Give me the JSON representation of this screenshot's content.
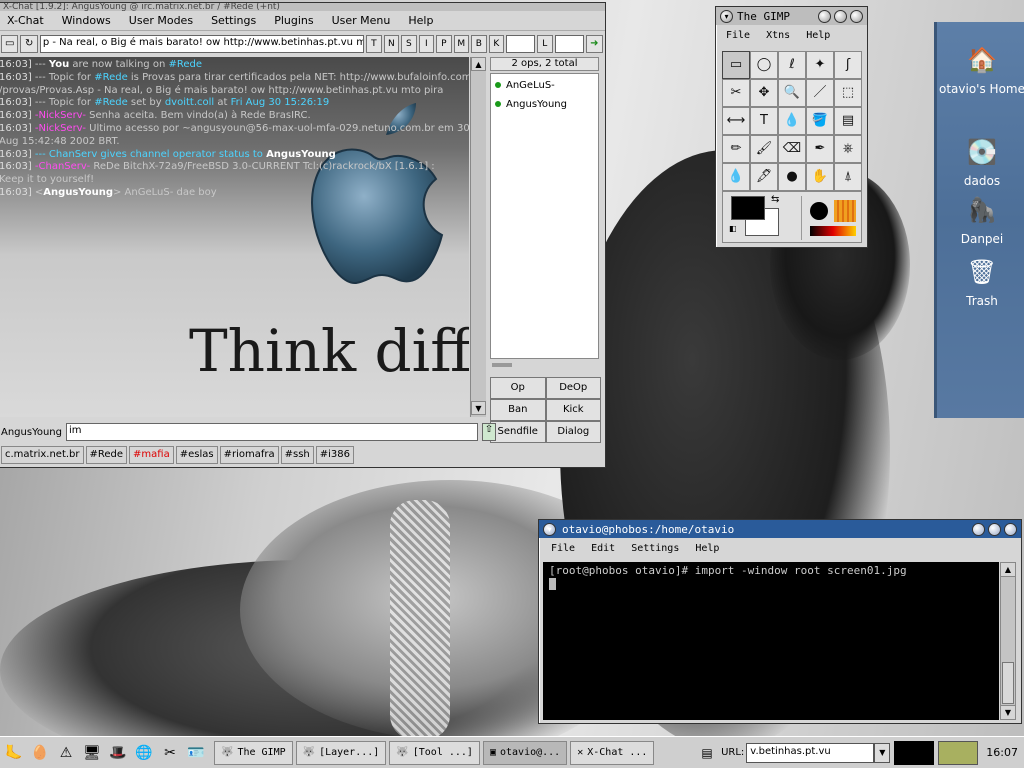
{
  "xchat": {
    "title": "X-Chat [1.9.2]: AngusYoung @ irc.matrix.net.br / #Rede (+nt)",
    "menu": [
      "X-Chat",
      "Windows",
      "User Modes",
      "Settings",
      "Plugins",
      "User Menu",
      "Help"
    ],
    "topic": "p - Na real, o Big é mais barato!  ow http://www.betinhas.pt.vu mto pira",
    "mode_buttons": [
      "T",
      "N",
      "S",
      "I",
      "P",
      "M",
      "B",
      "K"
    ],
    "limit_label": "L",
    "chat_lines": [
      {
        "ts": "16:03]",
        "parts": [
          {
            "t": " --- ",
            "c": "c-gray"
          },
          {
            "t": "You",
            "c": "c-bold"
          },
          {
            "t": " are now talking on ",
            "c": "c-gray"
          },
          {
            "t": "#Rede",
            "c": "c-cyan"
          }
        ]
      },
      {
        "ts": "16:03]",
        "parts": [
          {
            "t": " --- Topic for ",
            "c": "c-gray"
          },
          {
            "t": "#Rede",
            "c": "c-cyan"
          },
          {
            "t": " is Provas para tirar certificados pela NET: http://www.bufaloinfo.com.br",
            "c": "c-gray"
          }
        ]
      },
      {
        "ts": "",
        "parts": [
          {
            "t": "/provas/Provas.Asp - Na real, o Big é mais barato!  ow http://www.betinhas.pt.vu mto pira",
            "c": "c-gray"
          }
        ]
      },
      {
        "ts": "16:03]",
        "parts": [
          {
            "t": " --- Topic for ",
            "c": "c-gray"
          },
          {
            "t": "#Rede",
            "c": "c-cyan"
          },
          {
            "t": " set by ",
            "c": "c-gray"
          },
          {
            "t": "dvoitt.coll",
            "c": "c-cyan"
          },
          {
            "t": " at ",
            "c": "c-gray"
          },
          {
            "t": "Fri Aug 30 15:26:19",
            "c": "c-cyan"
          }
        ]
      },
      {
        "ts": "16:03]",
        "parts": [
          {
            "t": " -NickServ-",
            "c": "c-nick"
          },
          {
            "t": " Senha aceita. Bem vindo(a) à Rede BrasIRC.",
            "c": "c-gray"
          }
        ]
      },
      {
        "ts": "16:03]",
        "parts": [
          {
            "t": " -NickServ-",
            "c": "c-nick"
          },
          {
            "t": " Último acesso por ~angusyoun@56-max-uol-mfa-029.netuno.com.br em 30",
            "c": "c-gray"
          }
        ]
      },
      {
        "ts": "",
        "parts": [
          {
            "t": "Aug 15:42:48 2002 BRT.",
            "c": "c-gray"
          }
        ]
      },
      {
        "ts": "16:03]",
        "parts": [
          {
            "t": " --- ChanServ gives channel operator status to ",
            "c": "c-cyan"
          },
          {
            "t": "AngusYoung",
            "c": "c-bold"
          }
        ]
      },
      {
        "ts": "16:03]",
        "parts": [
          {
            "t": " -ChanServ-",
            "c": "c-nick"
          },
          {
            "t": " ReDe BitchX-72a9/FreeBSD 3.0-CURRENT Tcl:(c)rackrock/bX [1.6.1] :",
            "c": "c-gray"
          }
        ]
      },
      {
        "ts": "",
        "parts": [
          {
            "t": "Keep it to yourself!",
            "c": "c-gray"
          }
        ]
      },
      {
        "ts": "16:03]",
        "parts": [
          {
            "t": " <",
            "c": "c-gray"
          },
          {
            "t": "AngusYoung",
            "c": "c-bold"
          },
          {
            "t": "> AnGeLuS- dae boy",
            "c": "c-gray"
          }
        ]
      }
    ],
    "wallpaper_text": "Think diffe",
    "user_count": "2 ops, 2 total",
    "users": [
      "AnGeLuS-",
      "AngusYoung"
    ],
    "user_buttons": [
      "Op",
      "DeOp",
      "Ban",
      "Kick",
      "Sendfile",
      "Dialog"
    ],
    "nick": "AngusYoung",
    "input_value": "im",
    "tabs": [
      {
        "label": "c.matrix.net.br",
        "red": false
      },
      {
        "label": "#Rede",
        "red": false
      },
      {
        "label": "#mafia",
        "red": true
      },
      {
        "label": "#eslas",
        "red": false
      },
      {
        "label": "#riomafra",
        "red": false
      },
      {
        "label": "#ssh",
        "red": false
      },
      {
        "label": "#i386",
        "red": false
      }
    ]
  },
  "gimp": {
    "title": "The GIMP",
    "menu": [
      "File",
      "Xtns",
      "Help"
    ],
    "tools": [
      "▭",
      "◯",
      "ℓ",
      "✦",
      "ʃ",
      "✂",
      "✥",
      "🔍",
      "／",
      "⬚",
      "⟷",
      "T",
      "💧",
      "🪣",
      "▤",
      "✏",
      "🖌",
      "⌫",
      "✒",
      "⎈",
      "💧",
      "🖋",
      "●",
      "✋",
      "⍋"
    ]
  },
  "terminal": {
    "title": "otavio@phobos:/home/otavio",
    "menu": [
      "File",
      "Edit",
      "Settings",
      "Help"
    ],
    "prompt_line": "[root@phobos otavio]# import -window root screen01.jpg"
  },
  "desktop_icons": [
    {
      "label": "otavio's Home",
      "icon": "home-icon",
      "glyph": "🏠"
    },
    {
      "label": "dados",
      "icon": "disk-drive-icon",
      "glyph": "💽"
    },
    {
      "label": "Danpei",
      "icon": "gorilla-icon",
      "glyph": "🦍"
    },
    {
      "label": "Trash",
      "icon": "trash-icon",
      "glyph": "🗑"
    }
  ],
  "taskbar": {
    "launchers": [
      {
        "name": "gnome-foot-icon",
        "glyph": "🦶"
      },
      {
        "name": "egg-icon",
        "glyph": "🥚"
      },
      {
        "name": "warning-icon",
        "glyph": "⚠"
      },
      {
        "name": "computer-icon",
        "glyph": "🖥"
      },
      {
        "name": "redhat-icon",
        "glyph": "🎩"
      },
      {
        "name": "globe-icon",
        "glyph": "🌐"
      },
      {
        "name": "tools-icon",
        "glyph": "✂"
      },
      {
        "name": "card-icon",
        "glyph": "🪪"
      }
    ],
    "tasks": [
      {
        "label": "The GIMP",
        "pressed": false
      },
      {
        "label": "[Layer...]",
        "pressed": false
      },
      {
        "label": "[Tool ...]",
        "pressed": false
      },
      {
        "label": "otavio@...",
        "pressed": true
      },
      {
        "label": "X-Chat ...",
        "pressed": false
      }
    ],
    "url_label": "URL:",
    "url_value": "v.betinhas.pt.vu",
    "clock": "16:07"
  }
}
